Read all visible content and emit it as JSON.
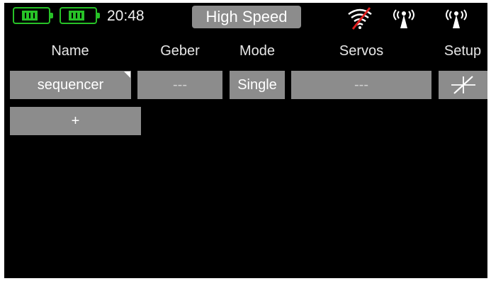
{
  "status_bar": {
    "battery_1_icon": "battery-icon",
    "battery_2_icon": "battery-icon",
    "time": "20:48",
    "mode_button_label": "High Speed",
    "wifi_icon": "wifi-off-icon",
    "antenna_1_icon": "antenna-signal-icon",
    "antenna_2_icon": "antenna-signal-icon",
    "battery_color": "#27c227",
    "wifi_off_color": "#e02020"
  },
  "columns": {
    "name": "Name",
    "geber": "Geber",
    "mode": "Mode",
    "servos": "Servos",
    "setup": "Setup"
  },
  "rows": [
    {
      "name": "sequencer",
      "geber": "---",
      "mode": "Single",
      "servos": "---",
      "setup_icon": "curve-setup-icon"
    }
  ],
  "add_button_label": "+",
  "colors": {
    "background": "#000000",
    "button": "#8c8c8c",
    "text": "#ffffff"
  }
}
